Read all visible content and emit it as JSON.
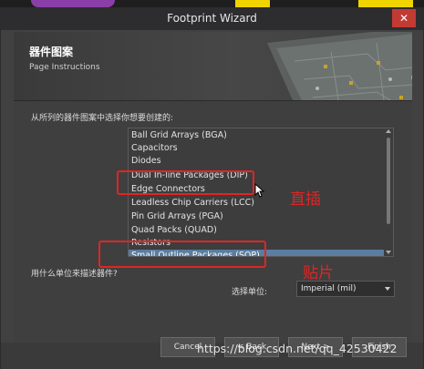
{
  "window": {
    "title": "Footprint Wizard",
    "close_glyph": "✕"
  },
  "header": {
    "title": "器件图案",
    "subtitle": "Page Instructions"
  },
  "prompt": "从所列的器件图案中选择你想要创建的:",
  "pattern_list": {
    "items": [
      "Ball Grid Arrays (BGA)",
      "Capacitors",
      "Diodes",
      "Dual In-line Packages (DIP)",
      "Edge Connectors",
      "Leadless Chip Carriers (LCC)",
      "Pin Grid Arrays (PGA)",
      "Quad Packs (QUAD)",
      "Resistors",
      "Small Outline Packages (SOP)"
    ],
    "selected": "Small Outline Packages (SOP)"
  },
  "units": {
    "question": "用什么单位来描述器件?",
    "label": "选择单位:",
    "value": "Imperial (mil)"
  },
  "buttons": {
    "cancel": "Cancel",
    "back": "< Back",
    "next": "Next >",
    "finish": "Finish"
  },
  "annotations": {
    "dip_note": "直插",
    "sop_note": "贴片"
  },
  "watermark": "https://blog.csdn.net/qq_42530422",
  "colors": {
    "selection": "#5b7d9f",
    "annotation_red": "#e02525",
    "close_button": "#c23a34"
  }
}
